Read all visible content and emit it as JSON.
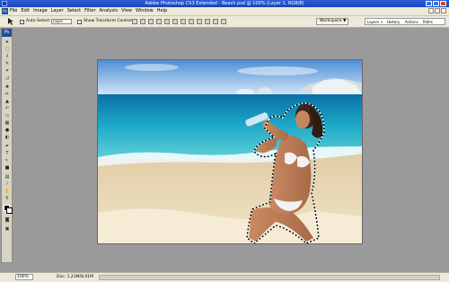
{
  "window": {
    "title": "Adobe Photoshop CS3 Extended - Beach.psd @ 100% (Layer 1, RGB/8)"
  },
  "menu": [
    "File",
    "Edit",
    "Image",
    "Layer",
    "Select",
    "Filter",
    "Analysis",
    "View",
    "Window",
    "Help"
  ],
  "app": {
    "logo_text": "Ps"
  },
  "options": {
    "auto_select_label": "Auto-Select:",
    "auto_select_value": "Layer",
    "show_transform_label": "Show Transform Controls",
    "workspace_label": "Workspace ▼"
  },
  "panel_well": {
    "tabs": [
      "Layers ×",
      "History",
      "Actions",
      "Paths"
    ]
  },
  "status": {
    "zoom": "100%",
    "doc": "Doc: 1,23M/8,91M"
  },
  "colors": {
    "title_bar": "#2b5fd9",
    "chrome": "#ece9d8",
    "workspace_bg": "#9a9a9a",
    "toolbox": "#d7d4c5"
  }
}
